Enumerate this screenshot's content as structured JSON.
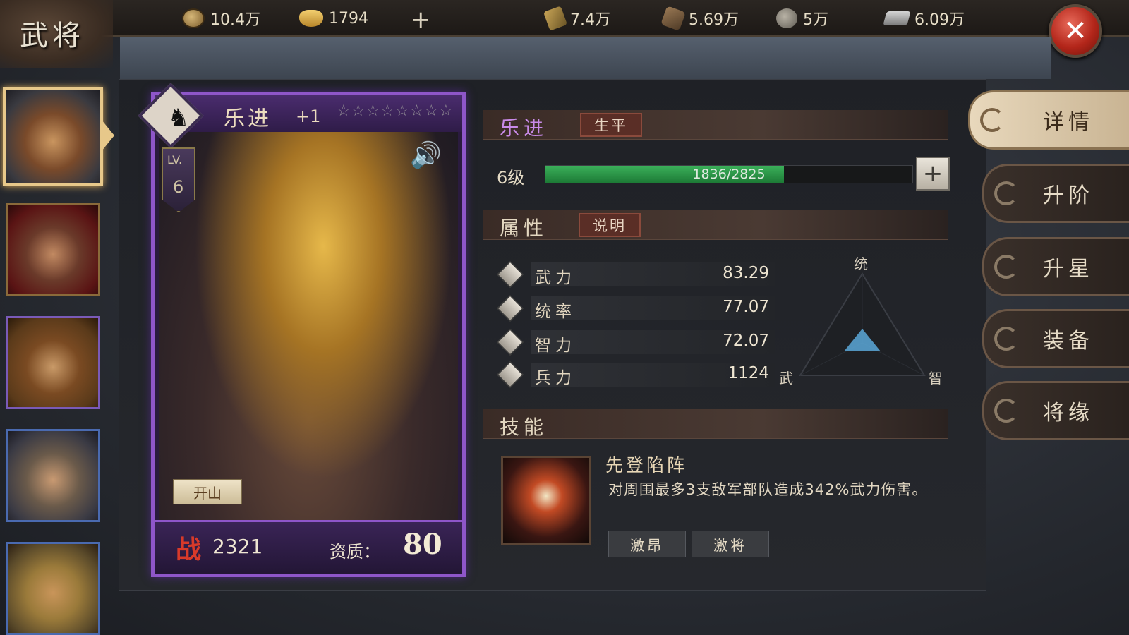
{
  "header": {
    "title": "武将",
    "resources": [
      {
        "icon": "copper-coin-icon",
        "value": "10.4万"
      },
      {
        "icon": "gold-ingot-icon",
        "value": "1794"
      },
      {
        "icon": "grain-icon",
        "value": "7.4万"
      },
      {
        "icon": "wood-icon",
        "value": "5.69万"
      },
      {
        "icon": "stone-icon",
        "value": "5万"
      },
      {
        "icon": "iron-icon",
        "value": "6.09万"
      }
    ],
    "add_label": "+",
    "close_label": "✕"
  },
  "card": {
    "name": "乐进",
    "plus": "+1",
    "stars": "☆☆☆☆☆☆☆☆",
    "star_count": 8,
    "level_label": "LV.",
    "level": "6",
    "badge": "开山",
    "zhan_icon": "战",
    "power": "2321",
    "aptitude_label": "资质：",
    "aptitude": "80"
  },
  "profile": {
    "name": "乐进",
    "bio_button": "生平",
    "level_text": "6级",
    "xp_text": "1836/2825",
    "xp_current": 1836,
    "xp_max": 2825,
    "xp_plus": "+"
  },
  "attributes": {
    "title": "属性",
    "explain_button": "说明",
    "rows": [
      {
        "icon": "sword-icon",
        "name": "武力",
        "value": "83.29"
      },
      {
        "icon": "flag-icon",
        "name": "统率",
        "value": "77.07"
      },
      {
        "icon": "hand-icon",
        "name": "智力",
        "value": "72.07"
      },
      {
        "icon": "troop-icon",
        "name": "兵力",
        "value": "1124"
      }
    ],
    "triangle": {
      "top": "统",
      "left": "武",
      "right": "智"
    }
  },
  "skills": {
    "title": "技能",
    "skill_name": "先登陷阵",
    "skill_desc": "对周围最多3支敌军部队造成342%武力伤害。",
    "buttons": [
      "激昂",
      "激将"
    ]
  },
  "tabs": [
    "详情",
    "升阶",
    "升星",
    "装备",
    "将缘"
  ],
  "colors": {
    "card_border": "#8e56c9",
    "xp_fill": "#3bb05a",
    "close_button": "#b3261a",
    "name_purple": "#c88ae8"
  }
}
